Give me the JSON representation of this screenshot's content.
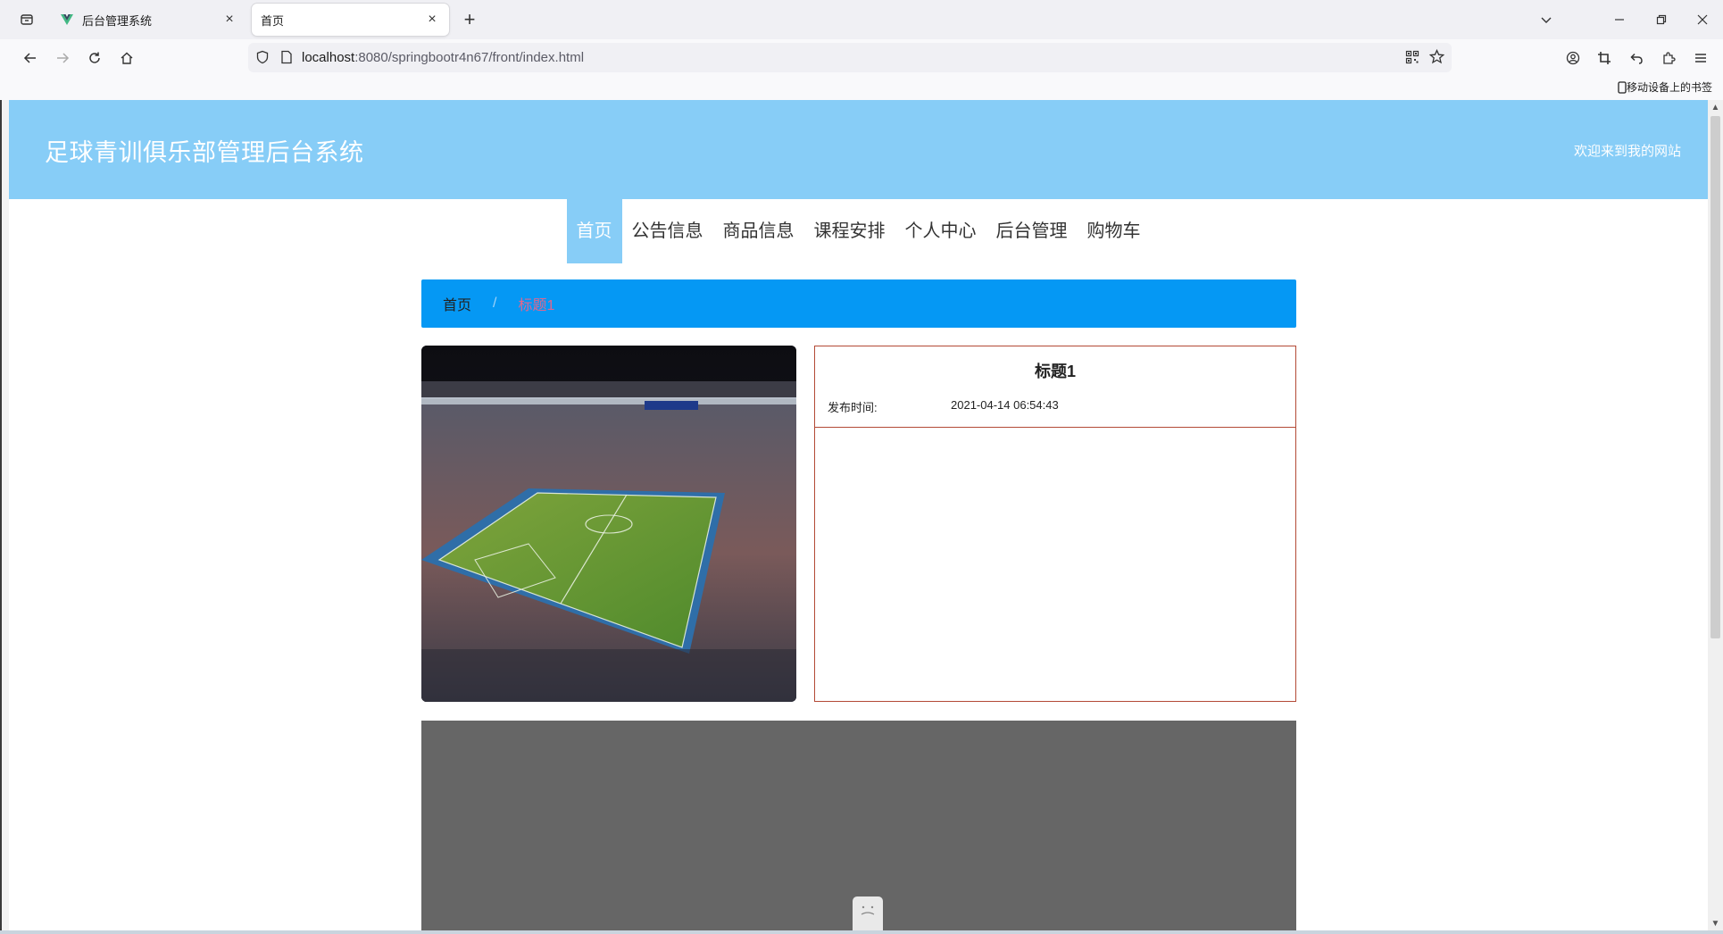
{
  "browser": {
    "tabs": [
      {
        "title": "后台管理系统",
        "active": false
      },
      {
        "title": "首页",
        "active": true
      }
    ],
    "url_host": "localhost",
    "url_rest": ":8080/springbootr4n67/front/index.html",
    "bookmark_mobile": "移动设备上的书签"
  },
  "site": {
    "title": "足球青训俱乐部管理后台系统",
    "welcome": "欢迎来到我的网站",
    "header_color": "#87cdf7",
    "menu": [
      "首页",
      "公告信息",
      "商品信息",
      "课程安排",
      "个人中心",
      "后台管理",
      "购物车"
    ],
    "active_menu": "首页"
  },
  "breadcrumb": {
    "home": "首页",
    "separator": "/",
    "current": "标题1",
    "bar_color": "#0598f4"
  },
  "detail": {
    "title": "标题1",
    "time_label": "发布时间:",
    "time_value": "2021-04-14 06:54:43",
    "border_color": "#b34a36"
  },
  "media": {
    "photo_alt": "stadium-photo",
    "video_placeholder_color": "#666666"
  }
}
